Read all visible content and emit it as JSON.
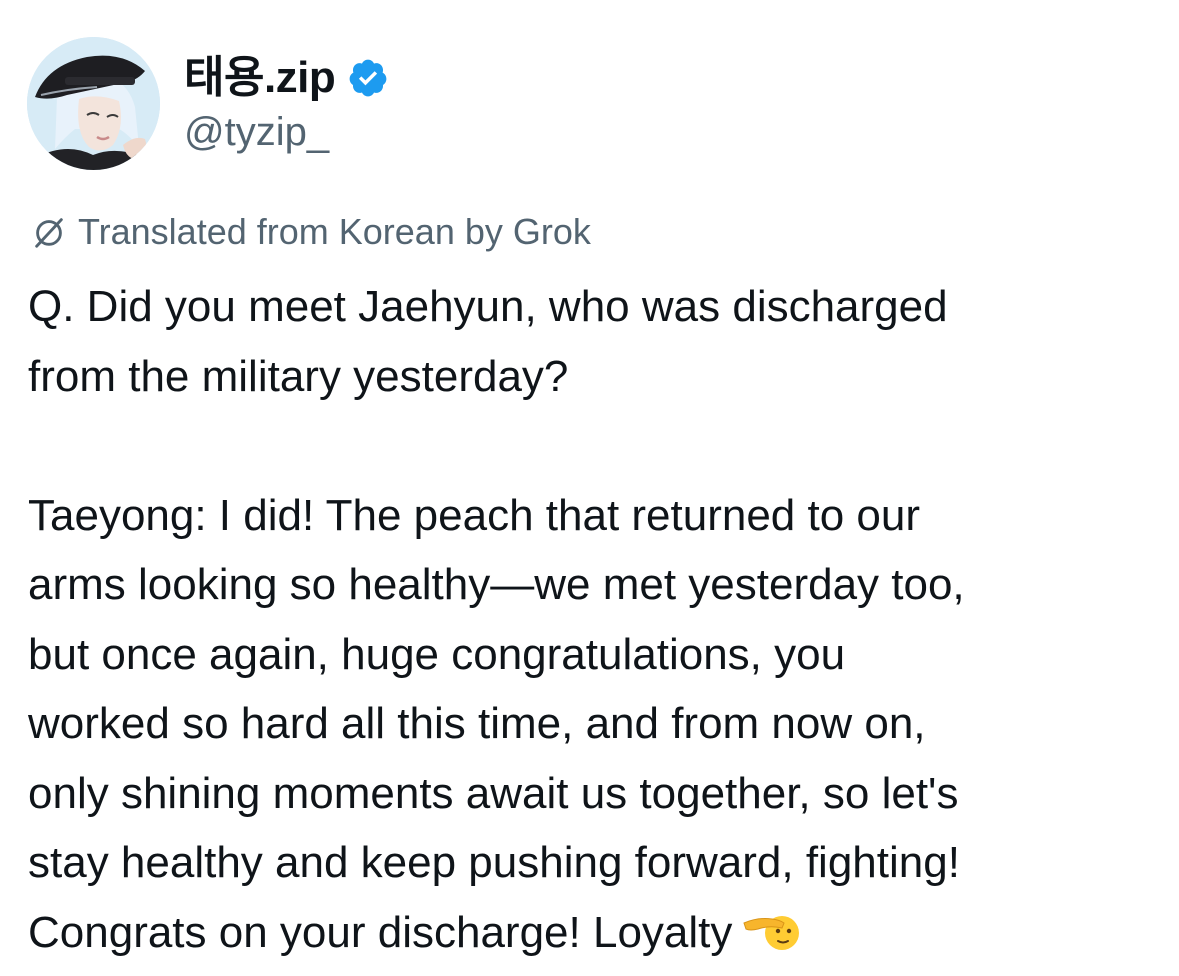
{
  "user": {
    "display_name": "태용.zip",
    "handle": "@tyzip_",
    "verified_icon": "verified-badge-icon",
    "verified_color": "#1d9bf0"
  },
  "translation": {
    "label": "Translated from Korean by Grok",
    "icon": "translate-icon"
  },
  "tweet": {
    "question_lines": [
      "Q. Did you meet Jaehyun, who was discharged",
      "from the military yesterday?"
    ],
    "answer_lines": [
      "Taeyong: I did! The peach that returned to our",
      "arms looking so healthy—we met yesterday too,",
      "but once again, huge congratulations, you",
      "worked so hard all this time, and from now on,",
      "only shining moments await us together, so let's",
      "stay healthy and keep pushing forward, fighting!",
      "Congrats on your discharge! Loyalty"
    ],
    "trailing_emoji": "saluting-face-emoji"
  },
  "colors": {
    "text": "#0f1419",
    "secondary": "#536471",
    "accent": "#1d9bf0"
  }
}
